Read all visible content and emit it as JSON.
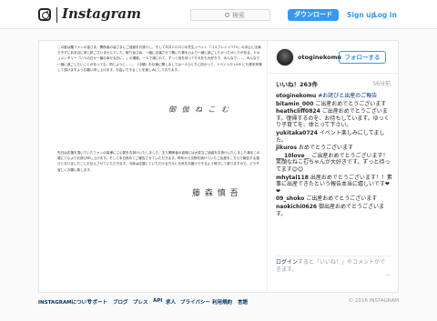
{
  "header": {
    "brand": "Instagram",
    "search_placeholder": "検索",
    "signup_button": "ダウンロード",
    "signup_link": "Sign up",
    "separator": "/",
    "login_link": "Log in"
  },
  "post": {
    "letter_top": "この度は羅ファンの皆さま、関係者の皆さまにご迷惑をお掛けし、そして平井ドロロジの先生イベント「コスプレイイベTV」の中止に出演できずにあ本当に申し訳ございませんでした。取り返さぬ、一緒に出演させて戴いた事を心より一緒に過ごしたかったゆとりがある。ドキュメンタリー「いつの日か一番の幸せな日に。」の撮影。一人で演じれて、ずっと気を持ってそれをも大好きで、みんなで……、みんなで一緒に過ごしたいことがあっても、同じように……。（中略）お仕事に関しましては一人ひとりに向かって、イベントや LIVE にも是非来場して頂けますようお願い申し上げます。お会いできることを楽しみにしております。",
    "signature_1": "御 伽 ね こ む",
    "letter_bottom": "先日は応援を頂いていたファンの皆様にご心配をお掛けいたしました。また関係者の皆様には大変なご迷惑をお掛けいたしました事をこの場にて心よりお詫び申し上げます。そして本日改めてご報告させていただきます。昨年から交際を続けていたご出産をこちらで報告する運びとなりましたことお伝えさせていただきます。今後は応援していただける方々に元気をお届けできるよう努力して参りますので、どうぞ宜しくお願い致します。",
    "signature_2": "藤 森 慎 吾"
  },
  "sidebar": {
    "username": "otoginekomu",
    "follow_button": "フォローする",
    "likes": "いいね！263件",
    "time_ago": "56分前",
    "comments": [
      {
        "user": "otoginekomu",
        "text": "#お詫びと出産のご報告"
      },
      {
        "user": "bitamin_000",
        "text": "ご出産おめでとうございます"
      },
      {
        "user": "heathcliff0824",
        "text": "ご出産おめでとうございます。復帰するのを、お待ちしています。ゆっくり子育てを、体とって下さい。"
      },
      {
        "user": "yukitaka0724",
        "text": "イベント楽しみにしてました。"
      },
      {
        "user": "jikuros",
        "text": "おめでとうございます"
      },
      {
        "user": "___10love__",
        "text": "ご出産おめでとうございます！笑顔なねこむちゃんが大好きです。ずっと待ってます😊😊"
      },
      {
        "user": "mhytal118",
        "text": "出産おめでとうございます！！素事に出産できたという報告本当に嬉しいです❤❤"
      },
      {
        "user": "09_shoko",
        "text": "ご出産おめでとうございます"
      },
      {
        "user": "naokichi0626",
        "text": "御出産おめでとうございます。"
      }
    ],
    "login_prompt_link": "ログイン",
    "login_prompt_text": "すると「いいね！」やコメントができます。",
    "more_icon": "…"
  },
  "footer": {
    "links": [
      "INSTAGRAMについて",
      "サポート",
      "ブログ",
      "プレス",
      "API",
      "求人",
      "プライバシー",
      "利用規約",
      "言語"
    ],
    "copyright": "© 2016 INSTAGRAM"
  }
}
